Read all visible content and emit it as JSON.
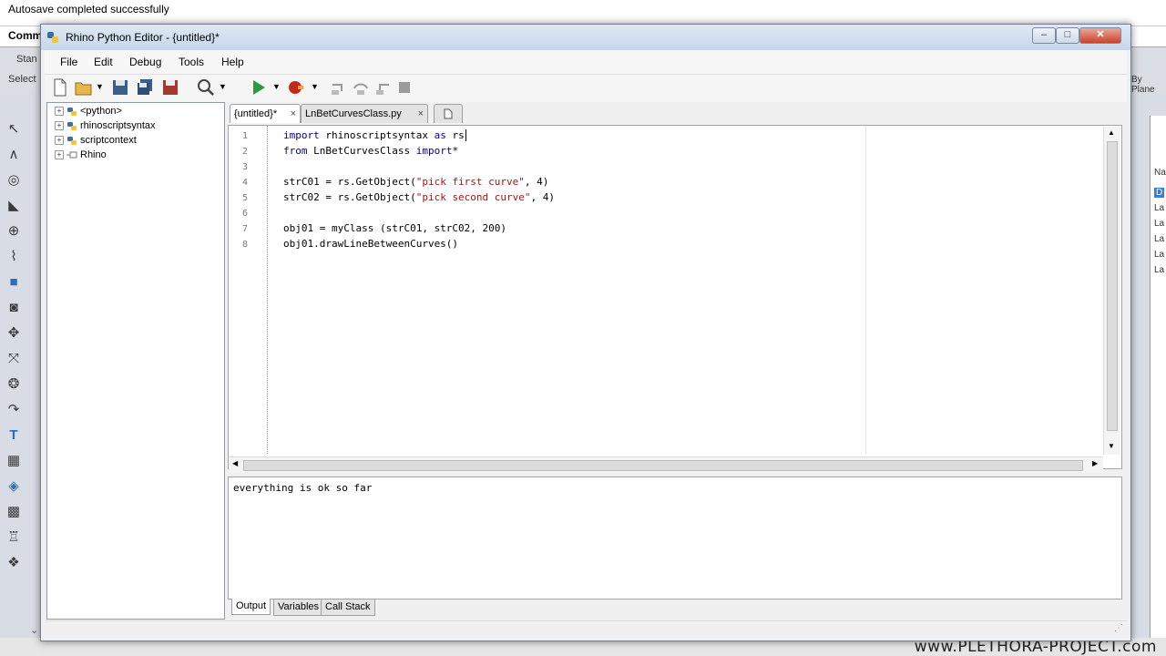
{
  "rhino": {
    "status_text": "Autosave completed successfully",
    "command_label": "Comm",
    "strip_label_1": "Stan",
    "strip_label_2": "Select",
    "right_label": "By Plane",
    "right_items": [
      "Na",
      "D",
      "La",
      "La",
      "La",
      "La",
      "La"
    ]
  },
  "editor_window": {
    "title": "Rhino Python Editor - {untitled}*",
    "menu": [
      "File",
      "Edit",
      "Debug",
      "Tools",
      "Help"
    ],
    "tree": {
      "items": [
        {
          "label": "<python>"
        },
        {
          "label": "rhinoscriptsyntax"
        },
        {
          "label": "scriptcontext"
        },
        {
          "label": "Rhino"
        }
      ]
    },
    "tabs": [
      {
        "label": "{untitled}*"
      },
      {
        "label": "LnBetCurvesClass.py"
      }
    ],
    "line_numbers": [
      "1",
      "2",
      "3",
      "4",
      "5",
      "6",
      "7",
      "8"
    ],
    "output_text": "everything is ok so far",
    "bottom_tabs": [
      "Output",
      "Variables",
      "Call Stack"
    ]
  },
  "watermark": "www.PLETHORA-PROJECT.com",
  "colors": {
    "keyword": "#00008b",
    "string": "#a31515",
    "titlebar": "#c6d6ea"
  }
}
